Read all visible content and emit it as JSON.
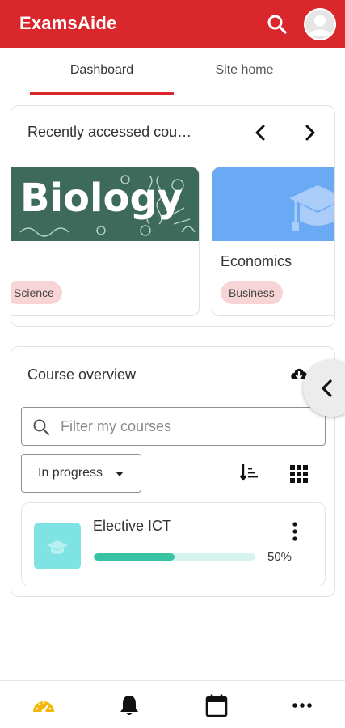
{
  "app": {
    "brand": "ExamsAide",
    "accent_color": "#d9272c"
  },
  "header": {
    "search_icon": "search-icon",
    "avatar_icon": "user-avatar"
  },
  "tabs": [
    {
      "label": "Dashboard",
      "active": true
    },
    {
      "label": "Site home",
      "active": false
    }
  ],
  "recent": {
    "title": "Recently accessed cou…",
    "prev_icon": "chevron-left-icon",
    "next_icon": "chevron-right-icon",
    "courses": [
      {
        "image_text": "Biology",
        "name": "",
        "category": "Science"
      },
      {
        "name": "Economics",
        "category": "Business"
      }
    ]
  },
  "overview": {
    "title": "Course overview",
    "filter_placeholder": "Filter my courses",
    "filter_value": "",
    "progress_filter": "In progress",
    "courses": [
      {
        "name": "Elective ICT",
        "progress": 50,
        "progress_label": "50%"
      }
    ]
  },
  "bottom_nav": [
    {
      "name": "dashboard-icon",
      "active": true,
      "color": "#f2b705"
    },
    {
      "name": "bell-icon",
      "active": false
    },
    {
      "name": "calendar-icon",
      "active": false
    },
    {
      "name": "more-horizontal-icon",
      "active": false
    }
  ]
}
